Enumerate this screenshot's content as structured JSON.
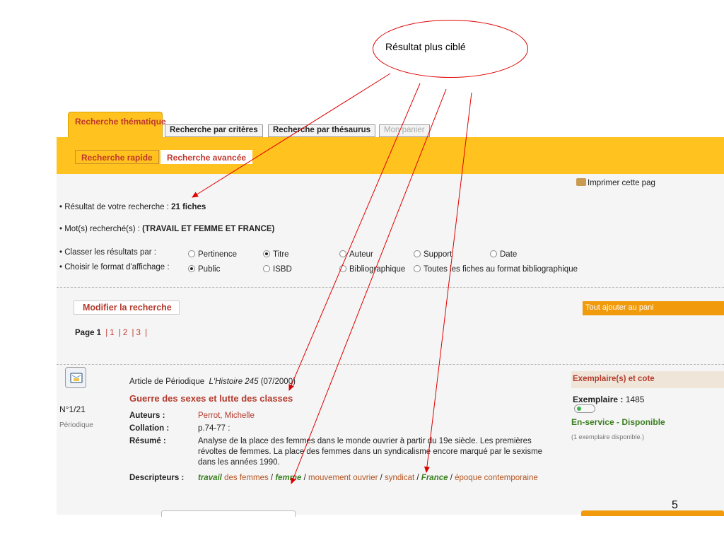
{
  "callout": {
    "text": "Résultat plus ciblé"
  },
  "tabs": [
    {
      "label": "Recherche thématique"
    },
    {
      "label": "Recherche par critères"
    },
    {
      "label": "Recherche par thésaurus"
    },
    {
      "label": "Mon panier"
    }
  ],
  "subtabs": [
    {
      "label": "Recherche rapide"
    },
    {
      "label": "Recherche avancée"
    }
  ],
  "print_label": "Imprimer cette pag",
  "result": {
    "prefix": "• Résultat de votre recherche : ",
    "count": "21 fiches"
  },
  "keywords": {
    "prefix": "• Mot(s) recherché(s) : ",
    "value": "(TRAVAIL ET FEMME ET FRANCE)"
  },
  "sort": {
    "label": "• Classer les résultats par :",
    "options": [
      "Pertinence",
      "Titre",
      "Auteur",
      "Support",
      "Date"
    ],
    "selected": "Titre"
  },
  "format": {
    "label": "• Choisir le format d'affichage :",
    "options": [
      "Public",
      "ISBD",
      "Bibliographique",
      "Toutes les fiches au format bibliographique"
    ],
    "selected": "Public"
  },
  "modify_button": "Modifier la recherche",
  "add_all_button": "Tout ajouter au pani",
  "pagination": {
    "label": "Page 1",
    "pages": [
      "1",
      "2",
      "3"
    ]
  },
  "record": {
    "number": "N°1/21",
    "type": "Périodique",
    "source_prefix": "Article de Périodique",
    "source_title": "L'Histoire 245",
    "source_date": "(07/2000)",
    "title": "Guerre des sexes et lutte des classes",
    "authors_label": "Auteurs :",
    "authors": "Perrot, Michelle",
    "collation_label": "Collation :",
    "collation": "p.74-77 :",
    "summary_label": "Résumé :",
    "summary_lines": [
      "Analyse de la place des femmes dans le monde ouvrier à partir du 19e siècle. Les premières",
      "révoltes de femmes. La place des femmes dans un syndicalisme encore marqué par le sexisme",
      "dans les années 1990."
    ],
    "descriptors_label": "Descripteurs :",
    "descriptors": {
      "d1": "travail",
      "d1_rest": " des femmes",
      "sep": " / ",
      "d2": "femme",
      "d3": "mouvement ouvrier",
      "d4": "syndicat",
      "d5": "France",
      "d6": "époque contemporaine"
    }
  },
  "copies": {
    "header": "Exemplaire(s) et cote",
    "label": "Exemplaire :",
    "number": "1485",
    "status": "En-service - Disponible",
    "note": "(1 exemplaire disponible.)"
  },
  "slide_number": "5",
  "colors": {
    "accent_yellow": "#ffc21e",
    "link_red": "#b43a2d",
    "green": "#3a7f1f",
    "orange": "#f09a0c",
    "arrow_red": "#e00000"
  }
}
